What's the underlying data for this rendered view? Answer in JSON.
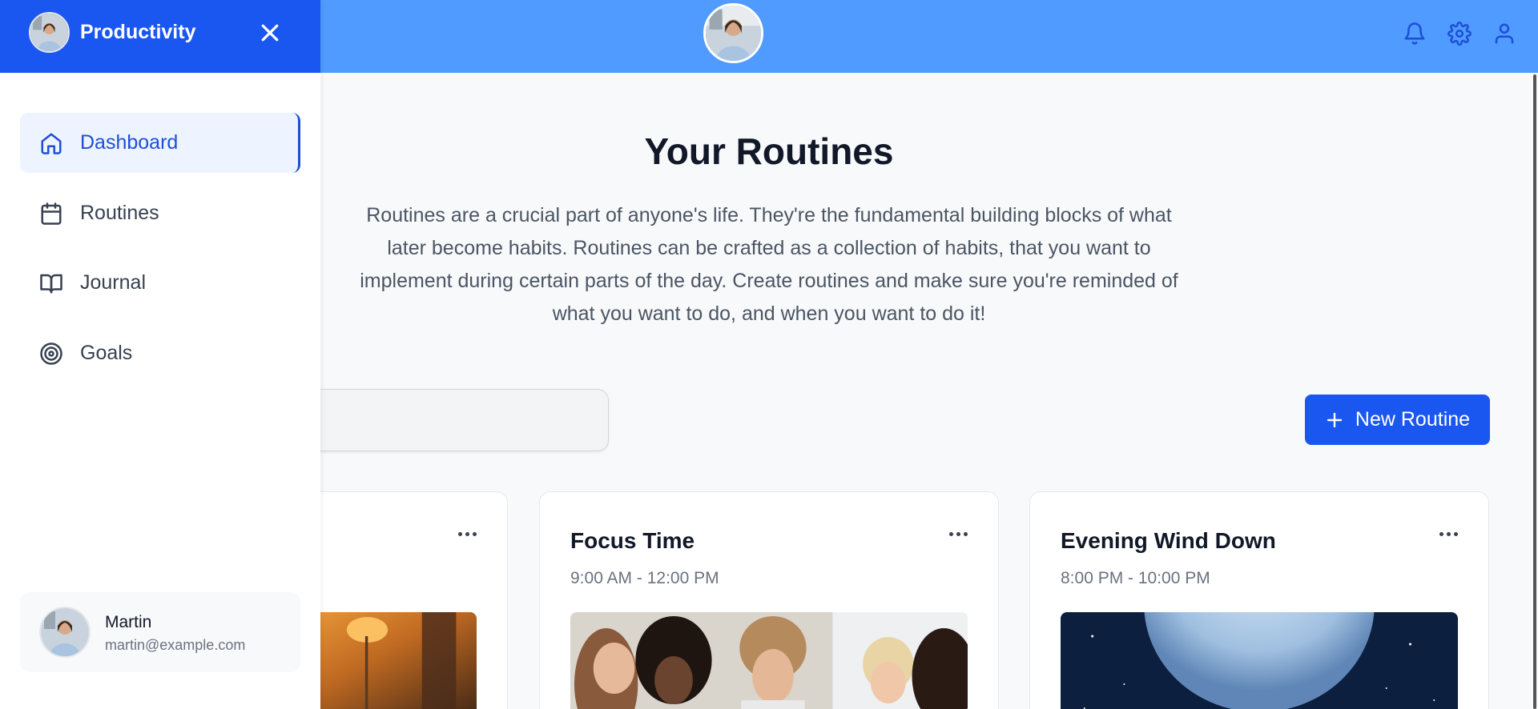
{
  "app": {
    "brand": "Productivity"
  },
  "header": {
    "icons": [
      "bell-icon",
      "gear-icon",
      "user-icon"
    ]
  },
  "sidebar": {
    "items": [
      {
        "label": "Dashboard",
        "icon": "home-icon",
        "active": true
      },
      {
        "label": "Routines",
        "icon": "calendar-icon",
        "active": false
      },
      {
        "label": "Journal",
        "icon": "book-icon",
        "active": false
      },
      {
        "label": "Goals",
        "icon": "target-icon",
        "active": false
      }
    ],
    "user": {
      "name": "Martin",
      "email": "martin@example.com"
    }
  },
  "main": {
    "title": "Your Routines",
    "description": "Routines are a crucial part of anyone's life. They're the fundamental building blocks of what later become habits. Routines can be crafted as a collection of habits, that you want to implement during certain parts of the day. Create routines and make sure you're reminded of what you want to do, and when you want to do it!",
    "search": {
      "placeholder": ""
    },
    "new_button": "New Routine",
    "cards": [
      {
        "title": "",
        "time": ""
      },
      {
        "title": "Focus Time",
        "time": "9:00 AM - 12:00 PM"
      },
      {
        "title": "Evening Wind Down",
        "time": "8:00 PM - 10:00 PM"
      }
    ]
  },
  "colors": {
    "topbar": "#4f9bff",
    "sidebar_header": "#1a56f0",
    "accent": "#1d4ed8",
    "button": "#1a56f0"
  }
}
